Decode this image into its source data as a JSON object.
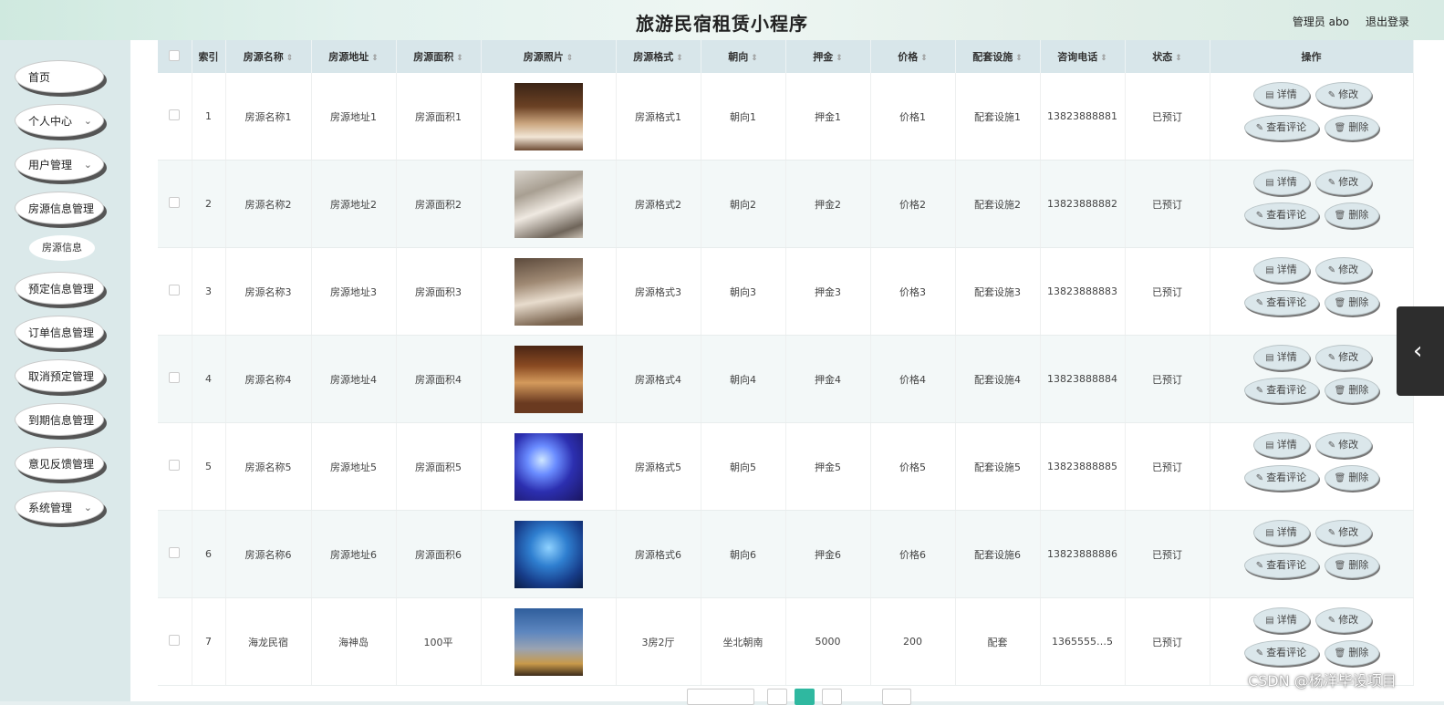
{
  "header": {
    "title": "旅游民宿租赁小程序",
    "user": "管理员 abo",
    "logout": "退出登录"
  },
  "sidebar": {
    "items": [
      {
        "label": "首页",
        "chevron": false
      },
      {
        "label": "个人中心",
        "chevron": true
      },
      {
        "label": "用户管理",
        "chevron": true
      },
      {
        "label": "房源信息管理",
        "chevron": false
      },
      {
        "label": "预定信息管理",
        "chevron": false
      },
      {
        "label": "订单信息管理",
        "chevron": false
      },
      {
        "label": "取消预定管理",
        "chevron": false
      },
      {
        "label": "到期信息管理",
        "chevron": false
      },
      {
        "label": "意见反馈管理",
        "chevron": false
      },
      {
        "label": "系统管理",
        "chevron": true
      }
    ],
    "sub_item": "房源信息"
  },
  "table": {
    "columns": [
      "索引",
      "房源名称",
      "房源地址",
      "房源面积",
      "房源照片",
      "房源格式",
      "朝向",
      "押金",
      "价格",
      "配套设施",
      "咨询电话",
      "状态",
      "操作"
    ],
    "rows": [
      {
        "index": "1",
        "name": "房源名称1",
        "address": "房源地址1",
        "area": "房源面积1",
        "format": "房源格式1",
        "orientation": "朝向1",
        "deposit": "押金1",
        "price": "价格1",
        "facilities": "配套设施1",
        "phone": "13823888881",
        "status": "已预订",
        "photo": "warm-hotel-bedroom"
      },
      {
        "index": "2",
        "name": "房源名称2",
        "address": "房源地址2",
        "area": "房源面积2",
        "format": "房源格式2",
        "orientation": "朝向2",
        "deposit": "押金2",
        "price": "价格2",
        "facilities": "配套设施2",
        "phone": "13823888882",
        "status": "已预订",
        "photo": "bright-suite"
      },
      {
        "index": "3",
        "name": "房源名称3",
        "address": "房源地址3",
        "area": "房源面积3",
        "format": "房源格式3",
        "orientation": "朝向3",
        "deposit": "押金3",
        "price": "价格3",
        "facilities": "配套设施3",
        "phone": "13823888883",
        "status": "已预订",
        "photo": "twin-bed-room"
      },
      {
        "index": "4",
        "name": "房源名称4",
        "address": "房源地址4",
        "area": "房源面积4",
        "format": "房源格式4",
        "orientation": "朝向4",
        "deposit": "押金4",
        "price": "价格4",
        "facilities": "配套设施4",
        "phone": "13823888884",
        "status": "已预订",
        "photo": "amber-suite"
      },
      {
        "index": "5",
        "name": "房源名称5",
        "address": "房源地址5",
        "area": "房源面积5",
        "format": "房源格式5",
        "orientation": "朝向5",
        "deposit": "押金5",
        "price": "价格5",
        "facilities": "配套设施5",
        "phone": "13823888885",
        "status": "已预订",
        "photo": "blue-theme-room"
      },
      {
        "index": "6",
        "name": "房源名称6",
        "address": "房源地址6",
        "area": "房源面积6",
        "format": "房源格式6",
        "orientation": "朝向6",
        "deposit": "押金6",
        "price": "价格6",
        "facilities": "配套设施6",
        "phone": "13823888886",
        "status": "已预订",
        "photo": "ocean-theme-room"
      },
      {
        "index": "7",
        "name": "海龙民宿",
        "address": "海神岛",
        "area": "100平",
        "format": "3房2厅",
        "orientation": "坐北朝南",
        "deposit": "5000",
        "price": "200",
        "facilities": "配套",
        "phone": "1365555…5",
        "status": "已预订",
        "photo": "hotel-building-dusk"
      }
    ],
    "actions": {
      "detail": "详情",
      "edit": "修改",
      "reviews": "查看评论",
      "delete": "删除"
    }
  },
  "watermark": "CSDN @杨洋毕设项目",
  "colors": {
    "accent": "#2fb8a0",
    "header_bg": "#d8e6ea",
    "sidebar_bg": "#dbe9ea"
  }
}
